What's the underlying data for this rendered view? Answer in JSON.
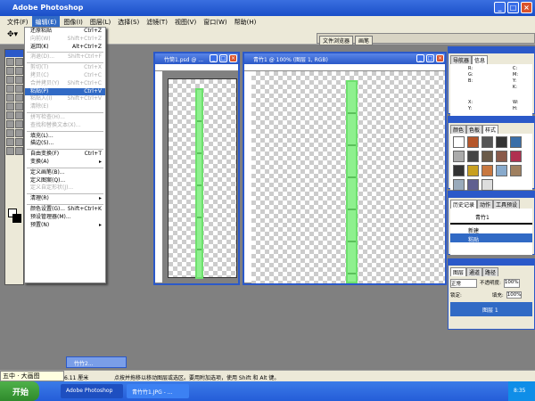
{
  "app": {
    "title": "Adobe Photoshop"
  },
  "menubar": [
    "文件(F)",
    "编辑(E)",
    "图像(I)",
    "图层(L)",
    "选择(S)",
    "滤镜(T)",
    "视图(V)",
    "窗口(W)",
    "帮助(H)"
  ],
  "palette_well": [
    "文件浏览器",
    "画笔"
  ],
  "edit_menu": [
    {
      "label": "还原粘贴",
      "shortcut": "Ctrl+Z",
      "state": "normal"
    },
    {
      "label": "向前(W)",
      "shortcut": "Shift+Ctrl+Z",
      "state": "disabled"
    },
    {
      "label": "返回(K)",
      "shortcut": "Alt+Ctrl+Z",
      "state": "normal"
    },
    {
      "sep": true
    },
    {
      "label": "消退(D)...",
      "shortcut": "Shift+Ctrl+F",
      "state": "disabled"
    },
    {
      "sep": true
    },
    {
      "label": "剪切(T)",
      "shortcut": "Ctrl+X",
      "state": "disabled"
    },
    {
      "label": "拷贝(C)",
      "shortcut": "Ctrl+C",
      "state": "disabled"
    },
    {
      "label": "合并拷贝(Y)",
      "shortcut": "Shift+Ctrl+C",
      "state": "disabled"
    },
    {
      "label": "粘贴(P)",
      "shortcut": "Ctrl+V",
      "state": "highlighted"
    },
    {
      "label": "粘贴入(I)",
      "shortcut": "Shift+Ctrl+V",
      "state": "disabled"
    },
    {
      "label": "清除(E)",
      "shortcut": "",
      "state": "disabled"
    },
    {
      "sep": true
    },
    {
      "label": "拼写检查(H)...",
      "shortcut": "",
      "state": "disabled"
    },
    {
      "label": "查找和替换文本(X)...",
      "shortcut": "",
      "state": "disabled"
    },
    {
      "sep": true
    },
    {
      "label": "填充(L)...",
      "shortcut": "",
      "state": "normal"
    },
    {
      "label": "描边(S)...",
      "shortcut": "",
      "state": "normal"
    },
    {
      "sep": true
    },
    {
      "label": "自由变换(F)",
      "shortcut": "Ctrl+T",
      "state": "normal"
    },
    {
      "label": "变换(A)",
      "shortcut": "▸",
      "state": "normal"
    },
    {
      "sep": true
    },
    {
      "label": "定义画笔(B)...",
      "shortcut": "",
      "state": "normal"
    },
    {
      "label": "定义图案(Q)...",
      "shortcut": "",
      "state": "normal"
    },
    {
      "label": "定义自定形状(J)...",
      "shortcut": "",
      "state": "disabled"
    },
    {
      "sep": true
    },
    {
      "label": "清理(R)",
      "shortcut": "▸",
      "state": "normal"
    },
    {
      "sep": true
    },
    {
      "label": "颜色设置(G)...",
      "shortcut": "Shift+Ctrl+K",
      "state": "normal"
    },
    {
      "label": "预设管理器(M)...",
      "shortcut": "",
      "state": "normal"
    },
    {
      "label": "预置(N)",
      "shortcut": "▸",
      "state": "normal"
    }
  ],
  "documents": {
    "left_title": "竹筒1.psd @ ...",
    "right_title": "青竹1 @ 100% (图层 1, RGB)",
    "minimized_title": "竹竹2..."
  },
  "navigator_panel": {
    "tabs": [
      "导航器",
      "信息"
    ],
    "labels": [
      "R:",
      "G:",
      "B:",
      "C:",
      "M:",
      "Y:",
      "K:",
      "X:",
      "Y:",
      "W:",
      "H:"
    ]
  },
  "swatches_panel": {
    "tabs": [
      "颜色",
      "色板",
      "样式"
    ]
  },
  "history_panel": {
    "tabs": [
      "历史记录",
      "动作",
      "工具预设"
    ],
    "snapshot": "青竹1",
    "items": [
      "新建",
      "粘贴"
    ],
    "selected": "粘贴"
  },
  "layers_panel": {
    "tabs": [
      "图层",
      "通道",
      "路径"
    ],
    "blend_mode": "正常",
    "opacity_label": "不透明度:",
    "opacity": "100%",
    "lock_label": "锁定:",
    "fill_label": "填充:",
    "fill": "100%",
    "layer_name": "图层 1"
  },
  "status": {
    "size": "6.11 厘米",
    "hint": "点按并拖移以移动图层或选区。要用附加选项，使用 Shift 和 Alt 键。"
  },
  "ime": "五中 · 大画图",
  "taskbar": {
    "start": "开始",
    "items": [
      "Adobe Photoshop",
      "青竹竹1.JPG - ..."
    ],
    "clock": "8:35"
  }
}
